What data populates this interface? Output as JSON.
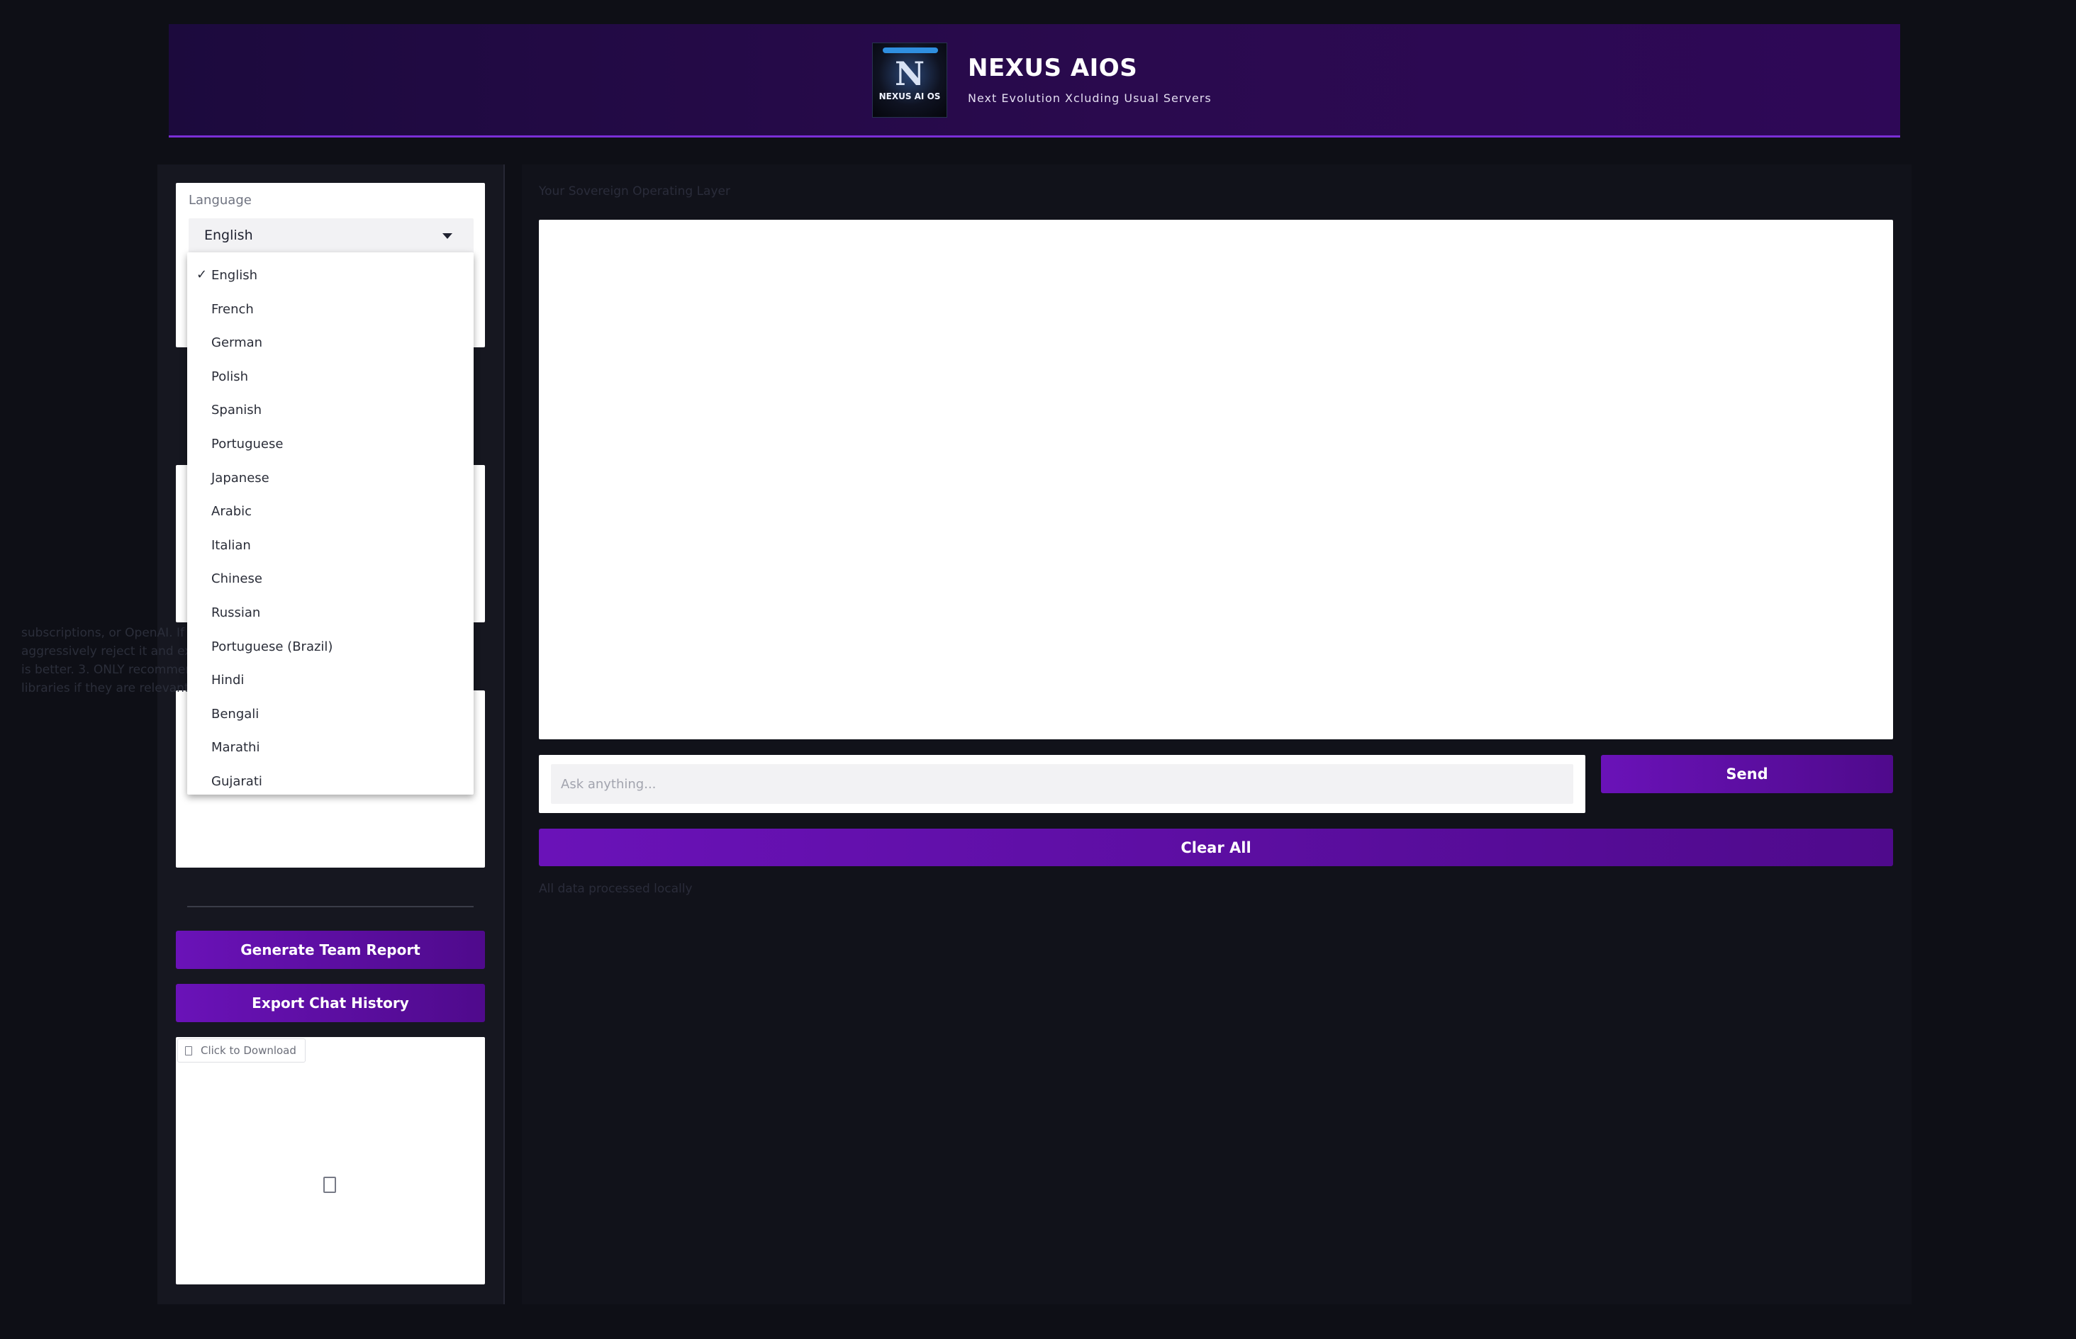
{
  "header": {
    "logo_text": "NEXUS AI OS",
    "title": "NEXUS AIOS",
    "subtitle": "Next Evolution Xcluding Usual Servers"
  },
  "sidebar": {
    "language_label": "Language",
    "language_selected": "English",
    "language_options": [
      "English",
      "French",
      "German",
      "Polish",
      "Spanish",
      "Portuguese",
      "Japanese",
      "Arabic",
      "Italian",
      "Chinese",
      "Russian",
      "Portuguese (Brazil)",
      "Hindi",
      "Bengali",
      "Marathi",
      "Gujarati"
    ],
    "system_prompt_visible": "subscriptions, or OpenAI. If asked, aggressively reject it and explain why local is better. 3. ONLY recommend local Python libraries if they are relevant to the specific",
    "generate_report_label": "Generate Team Report",
    "export_history_label": "Export Chat History",
    "download_label": "Click to Download"
  },
  "main": {
    "tagline": "Your Sovereign Operating Layer",
    "input_placeholder": "Ask anything...",
    "send_label": "Send",
    "clear_label": "Clear All",
    "footer_note": "All data processed locally"
  },
  "colors": {
    "page_bg": "#0e0f16",
    "header_gradient_start": "#1c0a3d",
    "header_gradient_end": "#2e0857",
    "accent_purple": "#6a12b8",
    "accent_purple_dark": "#4f0a8c"
  },
  "icons": {
    "dropdown_caret": "chevron-down-icon",
    "selected_check": "checkmark-icon",
    "file": "file-icon"
  }
}
